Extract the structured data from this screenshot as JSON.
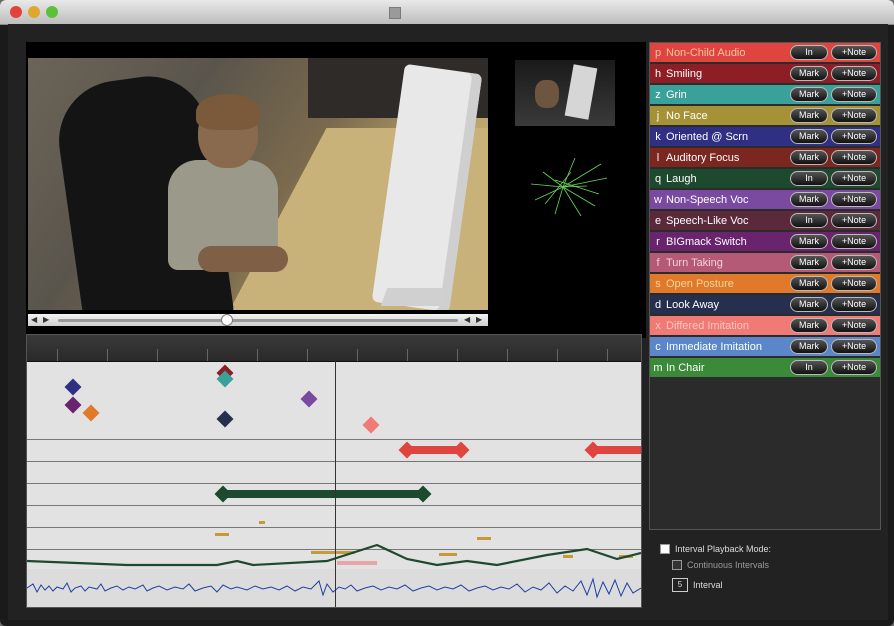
{
  "window": {
    "title_proxy_icon": "document-proxy-icon"
  },
  "video": {
    "controls": {
      "prev_icon": "◀",
      "play_icon": "▶",
      "rew_icon": "◀",
      "fwd_icon": "▶"
    },
    "progress_fraction": 0.42
  },
  "categories": [
    {
      "key": "p",
      "name": "Non-Child Audio",
      "button": "In",
      "note": "+Note",
      "color": "#e0443f",
      "text": "#f3c7a8"
    },
    {
      "key": "h",
      "name": "Smiling",
      "button": "Mark",
      "note": "+Note",
      "color": "#8d1e26",
      "text": "#ffffff"
    },
    {
      "key": "z",
      "name": "Grin",
      "button": "Mark",
      "note": "+Note",
      "color": "#3aa09a",
      "text": "#ffffff"
    },
    {
      "key": "j",
      "name": "No Face",
      "button": "Mark",
      "note": "+Note",
      "color": "#a59237",
      "text": "#ffffff"
    },
    {
      "key": "k",
      "name": "Oriented @ Scrn",
      "button": "Mark",
      "note": "+Note",
      "color": "#2f2f84",
      "text": "#ffffff"
    },
    {
      "key": "l",
      "name": "Auditory Focus",
      "button": "Mark",
      "note": "+Note",
      "color": "#7b261e",
      "text": "#ffffff"
    },
    {
      "key": "q",
      "name": "Laugh",
      "button": "In",
      "note": "+Note",
      "color": "#1d4a2e",
      "text": "#ffffff"
    },
    {
      "key": "w",
      "name": "Non-Speech Voc",
      "button": "Mark",
      "note": "+Note",
      "color": "#7a4aa0",
      "text": "#ffffff"
    },
    {
      "key": "e",
      "name": "Speech-Like Voc",
      "button": "In",
      "note": "+Note",
      "color": "#5a2a3a",
      "text": "#ffffff"
    },
    {
      "key": "r",
      "name": "BIGmack Switch",
      "button": "Mark",
      "note": "+Note",
      "color": "#6a246e",
      "text": "#ffffff"
    },
    {
      "key": "f",
      "name": "Turn Taking",
      "button": "Mark",
      "note": "+Note",
      "color": "#b55a76",
      "text": "#f6d0dc"
    },
    {
      "key": "s",
      "name": "Open Posture",
      "button": "Mark",
      "note": "+Note",
      "color": "#e07a2a",
      "text": "#f5d39c"
    },
    {
      "key": "d",
      "name": "Look Away",
      "button": "Mark",
      "note": "+Note",
      "color": "#26304e",
      "text": "#ffffff"
    },
    {
      "key": "x",
      "name": "Differed Imitation",
      "button": "Mark",
      "note": "+Note",
      "color": "#f07a76",
      "text": "#f9c6c0"
    },
    {
      "key": "c",
      "name": "Immediate Imitation",
      "button": "Mark",
      "note": "+Note",
      "color": "#5b86c9",
      "text": "#ffffff"
    },
    {
      "key": "m",
      "name": "In Chair",
      "button": "In",
      "note": "+Note",
      "color": "#3a8a3a",
      "text": "#ffffff"
    }
  ],
  "options": {
    "interval_playback_label": "Interval Playback Mode:",
    "continuous_label": "Continuous Intervals",
    "interval_value": "5",
    "interval_label": "Interval"
  },
  "colors": {
    "timeline_bg": "#e2e2e2",
    "green_bar": "#1d4a2e",
    "red_bar": "#e0443f",
    "smile_marker": "#8d1e26",
    "grin_marker": "#3aa09a",
    "oriented_marker": "#2f2f84",
    "nonspeech_marker": "#7a4aa0",
    "bigmack_marker": "#6a246e",
    "open_posture_marker": "#e07a2a",
    "differed_marker": "#f07a76",
    "look_away_marker": "#26304e"
  }
}
